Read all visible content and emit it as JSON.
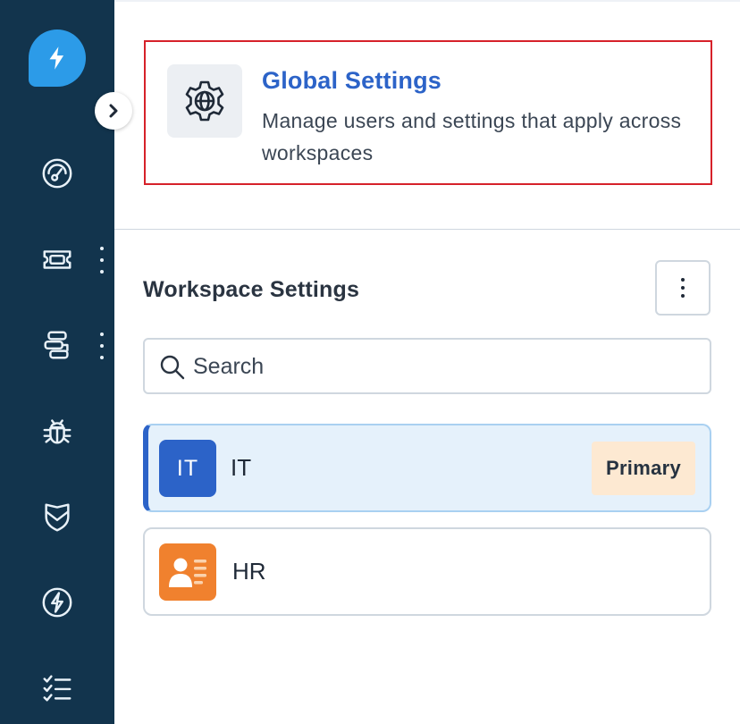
{
  "sidebar": {
    "logo": "freshservice-logo",
    "items": [
      {
        "icon": "gauge-icon",
        "has_more": false
      },
      {
        "icon": "ticket-icon",
        "has_more": true
      },
      {
        "icon": "flow-icon",
        "has_more": true
      },
      {
        "icon": "bug-icon",
        "has_more": false
      },
      {
        "icon": "shield-icon",
        "has_more": false
      },
      {
        "icon": "bolt-circle-icon",
        "has_more": false
      },
      {
        "icon": "checklist-icon",
        "has_more": false
      }
    ],
    "expand_icon": "chevron-right-icon"
  },
  "global_settings": {
    "title": "Global Settings",
    "description": "Manage users and settings that apply across workspaces",
    "icon": "gear-globe-icon",
    "highlight_color": "#d6212a"
  },
  "workspace_settings": {
    "title": "Workspace Settings",
    "menu_icon": "kebab-menu-icon",
    "search": {
      "placeholder": "Search",
      "value": ""
    },
    "workspaces": [
      {
        "initials": "IT",
        "name": "IT",
        "badge": "Primary",
        "active": true,
        "avatar_color": "#2c63c8"
      },
      {
        "initials": "",
        "name": "HR",
        "badge": "",
        "active": false,
        "avatar_color": "#f0812e",
        "avatar_icon": "id-card-icon"
      }
    ]
  },
  "colors": {
    "sidebar_bg": "#12344d",
    "accent": "#2c63c8",
    "logo": "#2c9be8"
  }
}
